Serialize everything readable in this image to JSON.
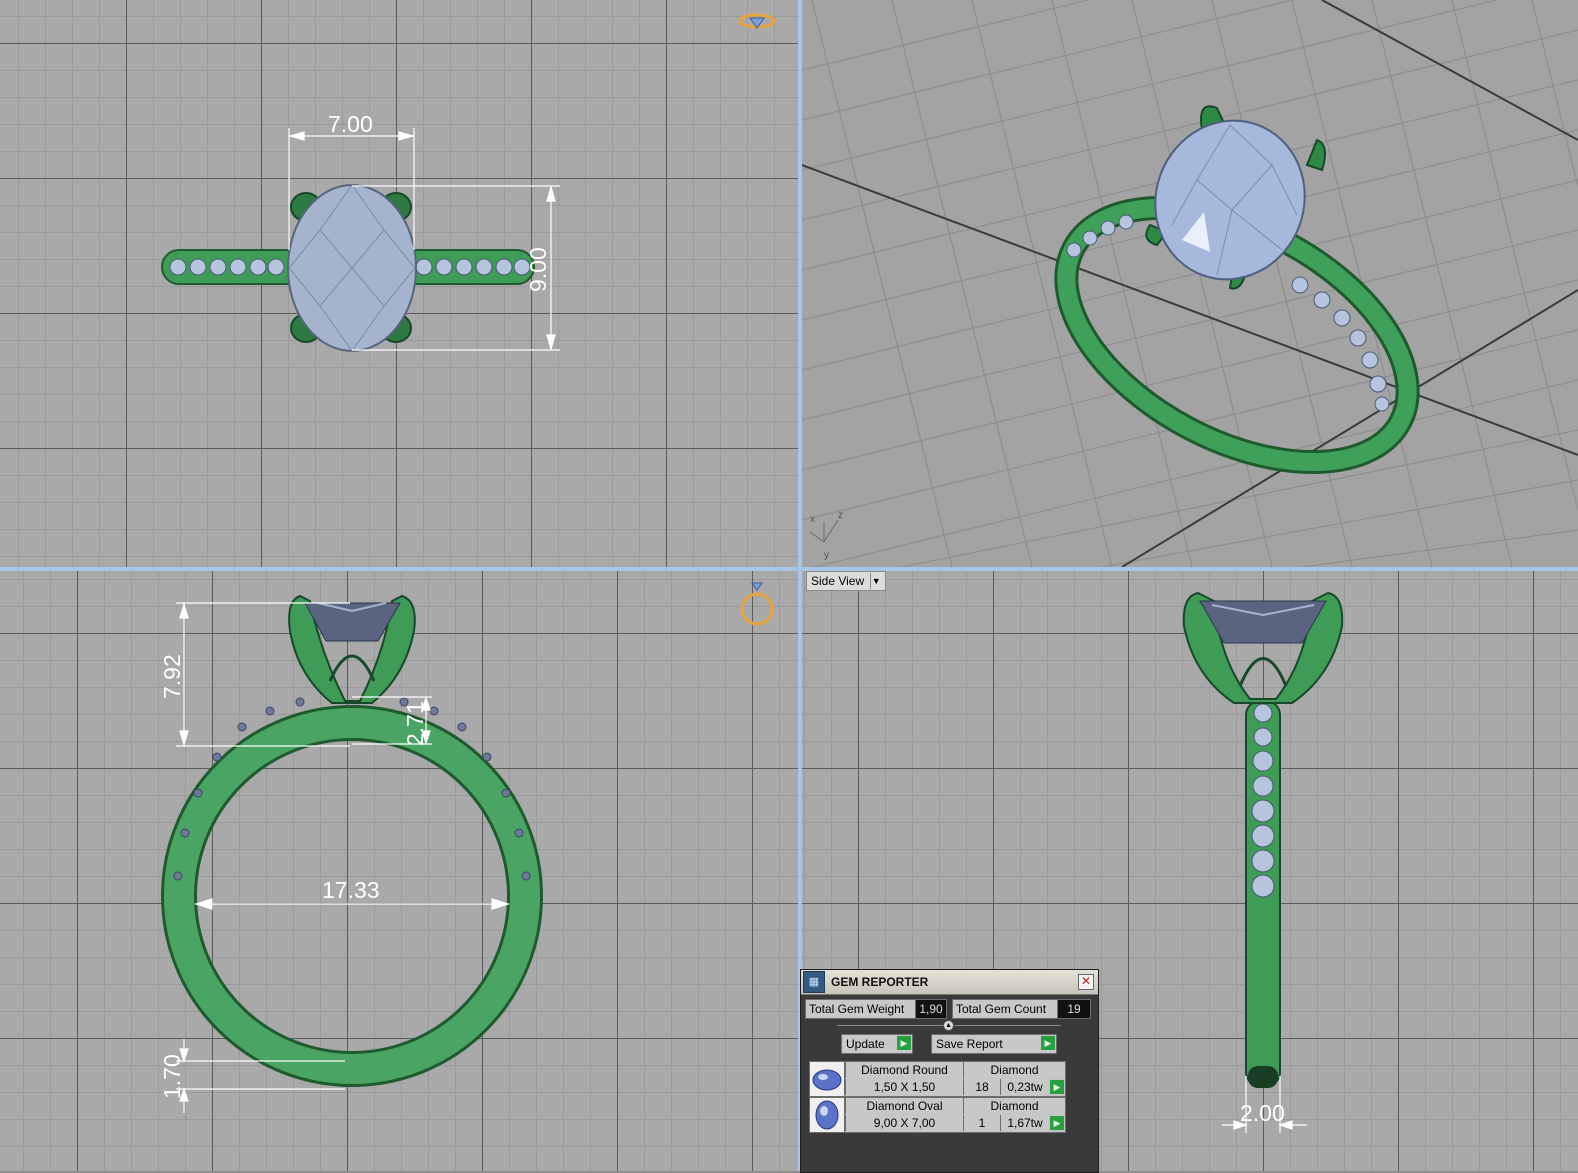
{
  "viewports": {
    "top": {
      "dim_width": "7.00",
      "dim_height": "9.00"
    },
    "front": {
      "dim_height": "7.92",
      "dim_shank": "2.71",
      "dim_diameter": "17.33",
      "dim_band": "1.70"
    },
    "side": {
      "label": "Side View",
      "dim_width": "2.00"
    }
  },
  "axes": {
    "x": "x",
    "y": "y",
    "z": "z"
  },
  "gem_reporter": {
    "title": "GEM REPORTER",
    "total_weight_label": "Total Gem Weight",
    "total_weight_value": "1,90",
    "total_count_label": "Total Gem Count",
    "total_count_value": "19",
    "update_label": "Update",
    "save_label": "Save Report",
    "rows": [
      {
        "name": "Diamond Round",
        "material": "Diamond",
        "size": "1,50 X 1,50",
        "count": "18",
        "weight": "0,23tw"
      },
      {
        "name": "Diamond Oval",
        "material": "Diamond",
        "size": "9,00 X 7,00",
        "count": "1",
        "weight": "1,67tw"
      }
    ]
  },
  "colors": {
    "metal": "#3f9c57",
    "gem": "#a9b8d6",
    "accent": "#e8a33c",
    "split": "#a8c4e8"
  }
}
